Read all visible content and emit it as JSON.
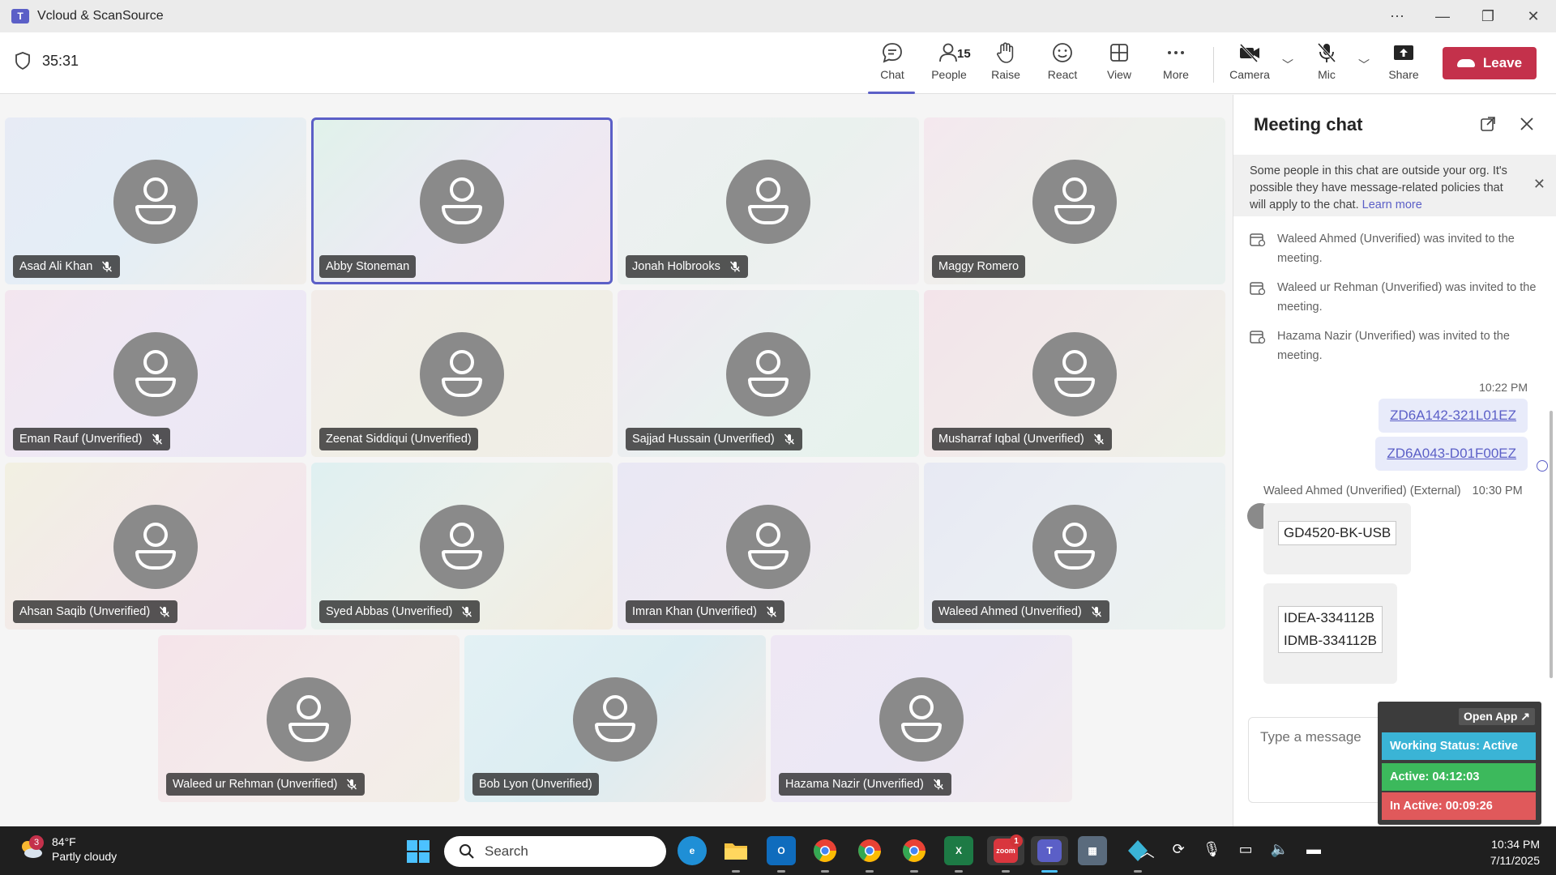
{
  "window": {
    "title": "Vcloud & ScanSource"
  },
  "meeting": {
    "timer": "35:31"
  },
  "toolbar": {
    "chat": "Chat",
    "people": "People",
    "people_count": "15",
    "raise": "Raise",
    "react": "React",
    "view": "View",
    "more": "More",
    "camera": "Camera",
    "mic": "Mic",
    "share": "Share",
    "leave": "Leave"
  },
  "participants": [
    {
      "name": "Asad Ali Khan",
      "muted": true,
      "speaking": false,
      "colors": [
        "#e7ebf5",
        "#e4eef6",
        "#f0ede9"
      ]
    },
    {
      "name": "Abby Stoneman",
      "muted": false,
      "speaking": true,
      "colors": [
        "#e0f2ea",
        "#eceaf4",
        "#f3e6ee"
      ]
    },
    {
      "name": "Jonah Holbrooks",
      "muted": true,
      "speaking": false,
      "colors": [
        "#eef0f2",
        "#eaf1ee",
        "#f1eef1"
      ]
    },
    {
      "name": "Maggy Romero",
      "muted": false,
      "speaking": false,
      "colors": [
        "#f4e8ee",
        "#eef0ec",
        "#e9f0ee"
      ]
    },
    {
      "name": "Eman Rauf (Unverified)",
      "muted": true,
      "speaking": false,
      "colors": [
        "#f3e6ef",
        "#eee9f5",
        "#ebe6f4"
      ]
    },
    {
      "name": "Zeenat Siddiqui (Unverified)",
      "muted": false,
      "speaking": false,
      "colors": [
        "#f2ece9",
        "#f0efe6",
        "#f1ede7"
      ]
    },
    {
      "name": "Sajjad Hussain (Unverified)",
      "muted": true,
      "speaking": false,
      "colors": [
        "#f0e7f2",
        "#e9f1ef",
        "#e6f2ec"
      ]
    },
    {
      "name": "Musharraf Iqbal (Unverified)",
      "muted": true,
      "speaking": false,
      "colors": [
        "#f3e4ea",
        "#f1ebea",
        "#eef1e7"
      ]
    },
    {
      "name": "Ahsan Saqib (Unverified)",
      "muted": true,
      "speaking": false,
      "colors": [
        "#f2f0e2",
        "#f3e9ea",
        "#f3e4ee"
      ]
    },
    {
      "name": "Syed Abbas (Unverified)",
      "muted": true,
      "speaking": false,
      "colors": [
        "#dff0f1",
        "#ecf1ec",
        "#f2ecdf"
      ]
    },
    {
      "name": "Imran Khan (Unverified)",
      "muted": true,
      "speaking": false,
      "colors": [
        "#e9e8f4",
        "#eee9f1",
        "#ecf0ea"
      ]
    },
    {
      "name": "Waleed Ahmed (Unverified)",
      "muted": true,
      "speaking": false,
      "colors": [
        "#e7e9f3",
        "#ebeff3",
        "#ebf2ee"
      ]
    },
    {
      "name": "Waleed ur Rehman (Unverified)",
      "muted": true,
      "speaking": false,
      "colors": [
        "#f5e4ea",
        "#f4ebeb",
        "#f2eee6"
      ]
    },
    {
      "name": "Bob Lyon (Unverified)",
      "muted": false,
      "speaking": false,
      "colors": [
        "#e3f1f4",
        "#dcedf2",
        "#f0eae7"
      ]
    },
    {
      "name": "Hazama Nazir (Unverified)",
      "muted": true,
      "speaking": false,
      "colors": [
        "#eee7f4",
        "#ece8f5",
        "#f2ebee"
      ]
    }
  ],
  "chat": {
    "title": "Meeting chat",
    "notice_text": "Some people in this chat are outside your org. It's possible they have message-related policies that will apply to the chat.",
    "notice_link": "Learn more",
    "system_messages": [
      "Waleed Ahmed (Unverified) was invited to the meeting.",
      "Waleed ur Rehman (Unverified) was invited to the meeting.",
      "Hazama Nazir (Unverified) was invited to the meeting."
    ],
    "my_time": "10:22 PM",
    "my_messages": [
      "ZD6A142-321L01EZ",
      "ZD6A043-D01F00EZ"
    ],
    "other_sender": "Waleed Ahmed (Unverified) (External)",
    "other_time": "10:30 PM",
    "other_msg1": "GD4520-BK-USB",
    "other_msg2_line1": "IDEA-334112B",
    "other_msg2_line2": "IDMB-334112B",
    "compose_placeholder": "Type a message"
  },
  "widget": {
    "open_app": "Open App ↗",
    "working_status": "Working Status: Active",
    "active": "Active: 04:12:03",
    "inactive": "In Active: 00:09:26"
  },
  "taskbar": {
    "weather_temp": "84°F",
    "weather_desc": "Partly cloudy",
    "weather_badge": "3",
    "search_placeholder": "Search",
    "time": "10:34 PM",
    "date": "7/11/2025",
    "zoom_badge": "1"
  }
}
